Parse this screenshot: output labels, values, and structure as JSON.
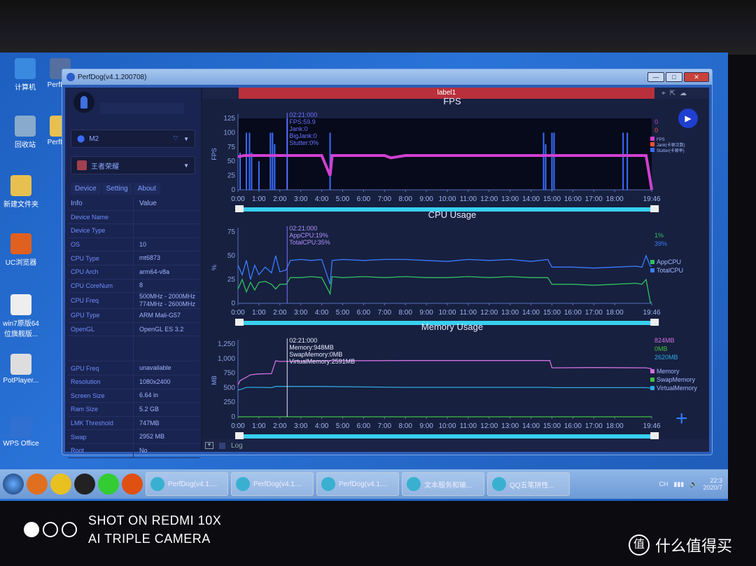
{
  "desktop": {
    "icons": [
      "计算机",
      "PerfDog",
      "回收站",
      "PerfDog",
      "新建文件夹",
      "UC浏览器",
      "win7原版64位旗舰版...",
      "PotPlayer...",
      "WPS Office"
    ]
  },
  "window": {
    "title": "PerfDog(v4.1.200708)",
    "min": "—",
    "max": "□",
    "close": "✕"
  },
  "sidebar": {
    "device": "M2",
    "app": "王者荣耀",
    "tabs": [
      "Device",
      "Setting",
      "About"
    ],
    "header": {
      "info": "Info",
      "value": "Value"
    },
    "rows": [
      {
        "k": "Device Name",
        "v": ""
      },
      {
        "k": "Device Type",
        "v": ""
      },
      {
        "k": "OS",
        "v": "10"
      },
      {
        "k": "CPU Type",
        "v": "mt6873"
      },
      {
        "k": "CPU Arch",
        "v": "arm64-v8a"
      },
      {
        "k": "CPU CoreNum",
        "v": "8"
      },
      {
        "k": "CPU Freq",
        "v": "500MHz - 2000MHz\n774MHz - 2600MHz"
      },
      {
        "k": "GPU Type",
        "v": "ARM Mali-G57"
      },
      {
        "k": "OpenGL",
        "v": "OpenGL ES 3.2"
      },
      {
        "k": "",
        "v": ""
      },
      {
        "k": "GPU Freq",
        "v": "unavailable"
      },
      {
        "k": "Resolution",
        "v": "1080x2400"
      },
      {
        "k": "Screen Size",
        "v": "6.64 in"
      },
      {
        "k": "Ram Size",
        "v": "5.2 GB"
      },
      {
        "k": "LMK Threshold",
        "v": "747MB"
      },
      {
        "k": "Swap",
        "v": "2952 MB"
      },
      {
        "k": "Root",
        "v": "No"
      }
    ]
  },
  "main": {
    "label": "label1",
    "log_label": "Log",
    "icons": [
      "location-icon",
      "export-icon",
      "cloud-icon"
    ]
  },
  "taskbar": {
    "items": [
      "PerfDog(v4.1....",
      "PerfDog(v4.1....",
      "PerfDog(v4.1....",
      "文本服务和输...",
      "QQ五笔拼性..."
    ],
    "tray": "CH",
    "clock": "22:3",
    "date": "2020/7"
  },
  "watermark": {
    "line1": "SHOT ON REDMI 10X",
    "line2": "AI TRIPLE CAMERA",
    "brand": "什么值得买",
    "brand_icon": "值"
  },
  "colors": {
    "fps": "#d040d0",
    "jank": "#ff5030",
    "stutter": "#3a6cff",
    "appcpu": "#30c060",
    "totalcpu": "#3a7cff",
    "memory": "#d070e0",
    "swap": "#40c040",
    "virtual": "#30a8e0"
  },
  "chart_data": [
    {
      "type": "line",
      "title": "FPS",
      "ylabel": "FPS",
      "ylim": [
        0,
        125
      ],
      "yticks": [
        "0",
        "25",
        "50",
        "75",
        "100",
        "125"
      ],
      "xticks": [
        "0:00",
        "1:00",
        "2:00",
        "3:00",
        "4:00",
        "5:00",
        "6:00",
        "7:00",
        "8:00",
        "9:00",
        "10:00",
        "11:00",
        "12:00",
        "13:00",
        "14:00",
        "15:00",
        "16:00",
        "17:00",
        "18:00",
        "19:46"
      ],
      "x_minutes": [
        0,
        0.3,
        1,
        2,
        3,
        4,
        4.4,
        4.5,
        5,
        6,
        7,
        7.3,
        8,
        9,
        10,
        11,
        12,
        13,
        14,
        15,
        16,
        17,
        18,
        19,
        19.5,
        19.77
      ],
      "series": [
        {
          "name": "FPS",
          "values": [
            58,
            60,
            60,
            60,
            60,
            60,
            25,
            60,
            60,
            60,
            60,
            56,
            60,
            60,
            60,
            60,
            60,
            60,
            60,
            60,
            60,
            60,
            60,
            60,
            60,
            0
          ]
        }
      ],
      "stutter_spikes_minutes": [
        0.1,
        0.4,
        0.55,
        0.65,
        1.0,
        1.55,
        1.65,
        1.75,
        2.35,
        4.4,
        14.6,
        14.7,
        15.0,
        15.1,
        18.4,
        18.6
      ],
      "stutter_spike_values": [
        65,
        100,
        100,
        65,
        50,
        100,
        100,
        80,
        125,
        100,
        100,
        80,
        100,
        100,
        100,
        100
      ],
      "legend": [
        "FPS",
        "Jank(卡顿次数)",
        "Stutter(卡顿率)"
      ],
      "legend_position": "right",
      "current": [
        "0",
        "0"
      ],
      "tooltip": [
        "02:21:000",
        "FPS:59.9",
        "Jank:0",
        "BigJank:0",
        "Stutter:0%"
      ],
      "cursor_minute": 2.35
    },
    {
      "type": "line",
      "title": "CPU Usage",
      "ylabel": "%",
      "ylim": [
        0,
        75
      ],
      "yticks": [
        "0",
        "25",
        "50",
        "75"
      ],
      "x_minutes": [
        0,
        0.2,
        0.4,
        0.6,
        0.8,
        1,
        1.3,
        1.6,
        1.8,
        2,
        2.3,
        2.5,
        3,
        3.5,
        4,
        4.4,
        4.5,
        5,
        6,
        7,
        8,
        9,
        10,
        11,
        12,
        13,
        14,
        14.8,
        15,
        16,
        17,
        18,
        19,
        19.3,
        19.5,
        19.7,
        19.77
      ],
      "series": [
        {
          "name": "AppCPU",
          "values": [
            15,
            25,
            12,
            22,
            14,
            22,
            23,
            20,
            15,
            20,
            20,
            27,
            27,
            28,
            27,
            10,
            28,
            27,
            28,
            27,
            28,
            27,
            27,
            28,
            27,
            28,
            27,
            27,
            20,
            20,
            19,
            20,
            21,
            20,
            25,
            1,
            1
          ]
        },
        {
          "name": "TotalCPU",
          "values": [
            40,
            30,
            45,
            25,
            40,
            30,
            38,
            32,
            50,
            33,
            35,
            45,
            46,
            45,
            46,
            20,
            45,
            46,
            45,
            46,
            46,
            45,
            44,
            46,
            45,
            46,
            44,
            46,
            38,
            38,
            37,
            38,
            39,
            38,
            50,
            39,
            39
          ]
        }
      ],
      "legend": [
        "AppCPU",
        "TotalCPU"
      ],
      "legend_position": "right",
      "current": [
        "1%",
        "39%"
      ],
      "tooltip": [
        "02:21:000",
        "AppCPU:19%",
        "TotalCPU:35%"
      ],
      "cursor_minute": 2.35
    },
    {
      "type": "line",
      "title": "Memory Usage",
      "ylabel": "MB",
      "ylim": [
        0,
        1250
      ],
      "yticks": [
        "0",
        "250",
        "500",
        "750",
        "1,000",
        "1,250"
      ],
      "x_minutes": [
        0,
        0.1,
        0.4,
        0.6,
        1,
        1.6,
        1.8,
        2,
        4,
        8,
        12,
        14.9,
        15,
        17,
        19.5,
        19.77
      ],
      "series": [
        {
          "name": "Memory",
          "values": [
            550,
            620,
            680,
            720,
            735,
            740,
            960,
            950,
            960,
            965,
            965,
            965,
            840,
            845,
            840,
            824
          ]
        },
        {
          "name": "SwapMemory",
          "values": [
            0,
            0,
            0,
            0,
            0,
            0,
            0,
            0,
            0,
            0,
            0,
            0,
            0,
            0,
            0,
            0
          ]
        },
        {
          "name": "VirtualMemory",
          "values": [
            460,
            465,
            505,
            505,
            505,
            500,
            520,
            520,
            520,
            505,
            505,
            505,
            500,
            500,
            500,
            490
          ]
        }
      ],
      "legend": [
        "Memory",
        "SwapMemory",
        "VirtualMemory"
      ],
      "legend_position": "right",
      "current": [
        "824MB",
        "0MB",
        "2620MB"
      ],
      "tooltip": [
        "02:21:000",
        "Memory:948MB",
        "SwapMemory:0MB",
        "VirtualMemory:2591MB"
      ],
      "cursor_minute": 2.35
    }
  ]
}
